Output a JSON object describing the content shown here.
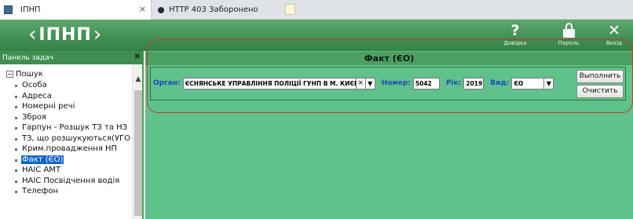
{
  "browser": {
    "tabs": [
      {
        "label": "ІПНП",
        "close": "×"
      },
      {
        "label": "HTTP 403 Заборонено"
      }
    ]
  },
  "header": {
    "logo_text": "ІПНП",
    "buttons": [
      {
        "icon": "help-icon",
        "glyph": "?",
        "label": "Довідка"
      },
      {
        "icon": "lock-icon",
        "label": "Пароль"
      },
      {
        "icon": "close-icon",
        "glyph": "✕",
        "label": "Вихід"
      }
    ],
    "colors": {
      "banner": "#3f8f53",
      "content_bg": "#5ec28a",
      "selection": "#0a64d6",
      "highlight_ring": "#d0332e"
    }
  },
  "sidebar": {
    "title": "Панель задач",
    "close_glyph": "✖",
    "root_label": "Пошук",
    "items": [
      {
        "label": "Особа"
      },
      {
        "label": "Адреса"
      },
      {
        "label": "Номерні речі"
      },
      {
        "label": "Зброя"
      },
      {
        "label": "Гарпун - Розшук ТЗ та НЗ"
      },
      {
        "label": "ТЗ, що розшукуються(УГО"
      },
      {
        "label": "Крим.провадження НП"
      },
      {
        "label": "Факт (ЄО)",
        "selected": true
      },
      {
        "label": "НАІС АМТ"
      },
      {
        "label": "НАІС Посвідчення водія"
      },
      {
        "label": "Телефон"
      }
    ]
  },
  "main": {
    "title": "Факт (ЄО)",
    "filters": {
      "organ_label": "Орган:",
      "organ_value": "ЄСНЯНСЬКЕ УПРАВЛІННЯ ПОЛІЦІЇ ГУНП В М. КИЄВІ",
      "organ_clear": "×",
      "number_label": "Номер:",
      "number_value": "5042",
      "year_label": "Рік:",
      "year_value": "2019",
      "type_label": "Вид:",
      "type_value": "ЄО"
    },
    "buttons": {
      "execute": "Выполнить",
      "clear": "Очистить"
    }
  }
}
